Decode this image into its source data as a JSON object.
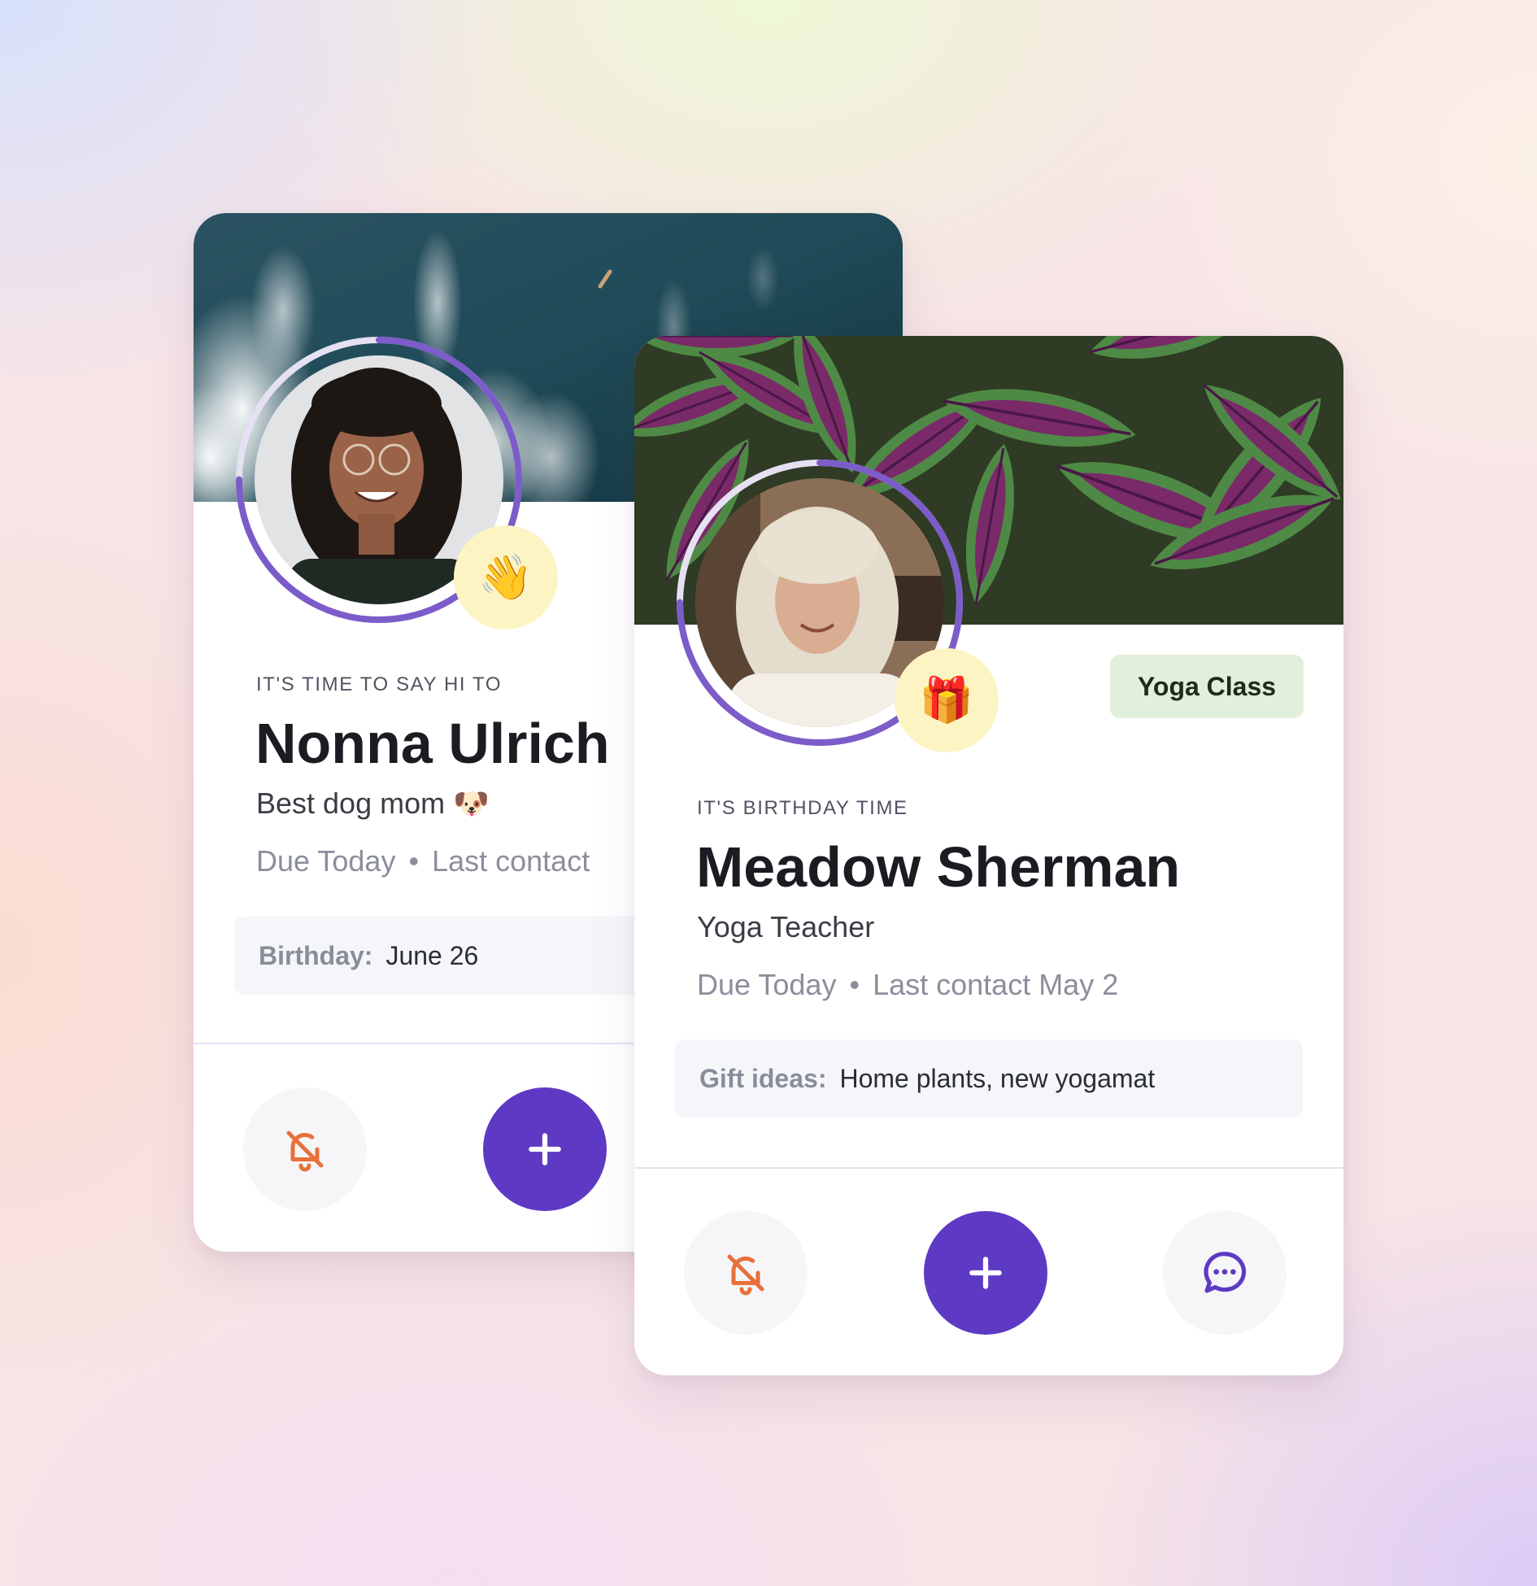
{
  "colors": {
    "accent_purple": "#5e3ac4",
    "ring_purple": "#7c5cc8",
    "bell_orange": "#e8703a",
    "tag_green_bg": "#e2efda",
    "emoji_badge_bg": "#fdf4c4"
  },
  "cards": [
    {
      "cover_image": "ocean-waves-aerial",
      "avatar_image": "woman-curly-hair-glasses",
      "badge_emoji": "👋",
      "eyebrow": "IT'S TIME TO SAY HI TO",
      "name": "Nonna Ulrich",
      "subtitle": "Best dog mom 🐶",
      "due": "Due Today",
      "last_contact": "Last contact",
      "info_label": "Birthday:",
      "info_value": "June 26",
      "progress_fraction": 0.75,
      "actions": [
        "mute-reminder-icon",
        "add-icon"
      ]
    },
    {
      "cover_image": "coleus-leaves",
      "avatar_image": "woman-white-hair",
      "badge_emoji": "🎁",
      "tag": "Yoga Class",
      "eyebrow": "IT'S BIRTHDAY TIME",
      "name": "Meadow Sherman",
      "subtitle": "Yoga Teacher",
      "due": "Due Today",
      "last_contact": "Last contact May 2",
      "info_label": "Gift ideas:",
      "info_value": "Home plants, new yogamat",
      "progress_fraction": 0.75,
      "actions": [
        "mute-reminder-icon",
        "add-icon",
        "chat-icon"
      ]
    }
  ]
}
